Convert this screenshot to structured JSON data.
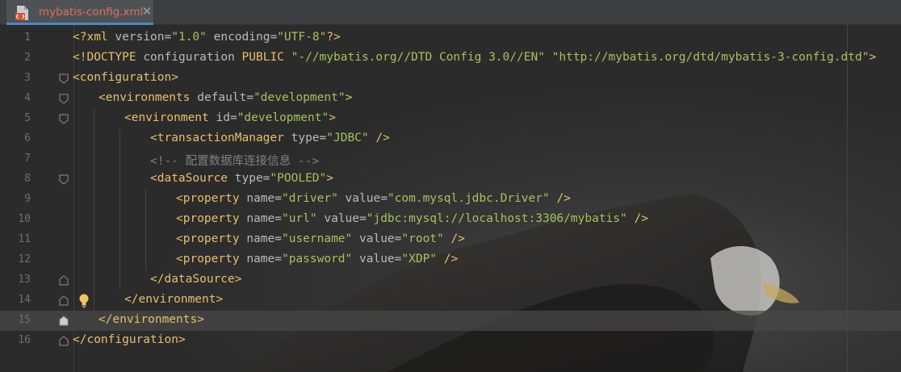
{
  "tab": {
    "title": "mybatis-config.xml",
    "close": "✕"
  },
  "editor": {
    "lines": [
      {
        "n": "1",
        "indent": 0,
        "tokens": [
          [
            "tag",
            "<?xml "
          ],
          [
            "attr",
            "version="
          ],
          [
            "val",
            "\"1.0\""
          ],
          [
            "attr",
            " encoding="
          ],
          [
            "val",
            "\"UTF-8\""
          ],
          [
            "tag",
            "?>"
          ]
        ]
      },
      {
        "n": "2",
        "indent": 0,
        "tokens": [
          [
            "tag",
            "<!DOCTYPE "
          ],
          [
            "attr",
            "configuration "
          ],
          [
            "tag",
            "PUBLIC "
          ],
          [
            "val",
            "\"-//mybatis.org//DTD Config 3.0//EN\" \"http://mybatis.org/dtd/mybatis-3-config.dtd\""
          ],
          [
            "tag",
            ">"
          ]
        ]
      },
      {
        "n": "3",
        "indent": 0,
        "tokens": [
          [
            "tag",
            "<configuration>"
          ]
        ]
      },
      {
        "n": "4",
        "indent": 1,
        "tokens": [
          [
            "tag",
            "<environments "
          ],
          [
            "attr",
            "default="
          ],
          [
            "val",
            "\"development\""
          ],
          [
            "tag",
            ">"
          ]
        ]
      },
      {
        "n": "5",
        "indent": 2,
        "tokens": [
          [
            "tag",
            "<environment "
          ],
          [
            "attr",
            "id="
          ],
          [
            "val",
            "\"development\""
          ],
          [
            "tag",
            ">"
          ]
        ]
      },
      {
        "n": "6",
        "indent": 3,
        "tokens": [
          [
            "tag",
            "<transactionManager "
          ],
          [
            "attr",
            "type="
          ],
          [
            "val",
            "\"JDBC\""
          ],
          [
            "tag",
            " />"
          ]
        ]
      },
      {
        "n": "7",
        "indent": 3,
        "tokens": [
          [
            "comment",
            "<!-- 配置数据库连接信息 -->"
          ]
        ]
      },
      {
        "n": "8",
        "indent": 3,
        "tokens": [
          [
            "tag",
            "<dataSource "
          ],
          [
            "attr",
            "type="
          ],
          [
            "val",
            "\"POOLED\""
          ],
          [
            "tag",
            ">"
          ]
        ]
      },
      {
        "n": "9",
        "indent": 4,
        "tokens": [
          [
            "tag",
            "<property "
          ],
          [
            "attr",
            "name="
          ],
          [
            "val",
            "\"driver\""
          ],
          [
            "attr",
            " value="
          ],
          [
            "val",
            "\"com.mysql.jdbc.Driver\""
          ],
          [
            "tag",
            " />"
          ]
        ]
      },
      {
        "n": "10",
        "indent": 4,
        "tokens": [
          [
            "tag",
            "<property "
          ],
          [
            "attr",
            "name="
          ],
          [
            "val",
            "\"url\""
          ],
          [
            "attr",
            " value="
          ],
          [
            "val",
            "\"jdbc:mysql://localhost:3306/mybatis\""
          ],
          [
            "tag",
            " />"
          ]
        ]
      },
      {
        "n": "11",
        "indent": 4,
        "tokens": [
          [
            "tag",
            "<property "
          ],
          [
            "attr",
            "name="
          ],
          [
            "val",
            "\"username\""
          ],
          [
            "attr",
            " value="
          ],
          [
            "val",
            "\"root\""
          ],
          [
            "tag",
            " />"
          ]
        ]
      },
      {
        "n": "12",
        "indent": 4,
        "tokens": [
          [
            "tag",
            "<property "
          ],
          [
            "attr",
            "name="
          ],
          [
            "val",
            "\"password\""
          ],
          [
            "attr",
            " value="
          ],
          [
            "val",
            "\"XDP\""
          ],
          [
            "tag",
            " />"
          ]
        ]
      },
      {
        "n": "13",
        "indent": 3,
        "tokens": [
          [
            "tag",
            "</dataSource>"
          ]
        ]
      },
      {
        "n": "14",
        "indent": 2,
        "tokens": [
          [
            "tag",
            "</environment>"
          ]
        ]
      },
      {
        "n": "15",
        "indent": 1,
        "tokens": [
          [
            "tag",
            "</environments>"
          ]
        ]
      },
      {
        "n": "16",
        "indent": 0,
        "tokens": [
          [
            "tag",
            "</configuration>"
          ]
        ]
      }
    ],
    "current_line": 15,
    "fold_lines": [
      3,
      4,
      5,
      8,
      13,
      14,
      15,
      16
    ],
    "bulb_line": 14
  },
  "colors": {
    "background": "#2b2b2b",
    "tag": "#e8bf6a",
    "attribute": "#bababa",
    "value": "#a5c25c",
    "comment": "#808080",
    "line_number": "#6a6f74",
    "tab_title": "#e06c5f",
    "tab_underline": "#4a88c7"
  },
  "icons": {
    "file": "xml-file-icon",
    "close": "close-icon",
    "fold": "fold-marker-icon",
    "bulb": "lightbulb-icon"
  }
}
